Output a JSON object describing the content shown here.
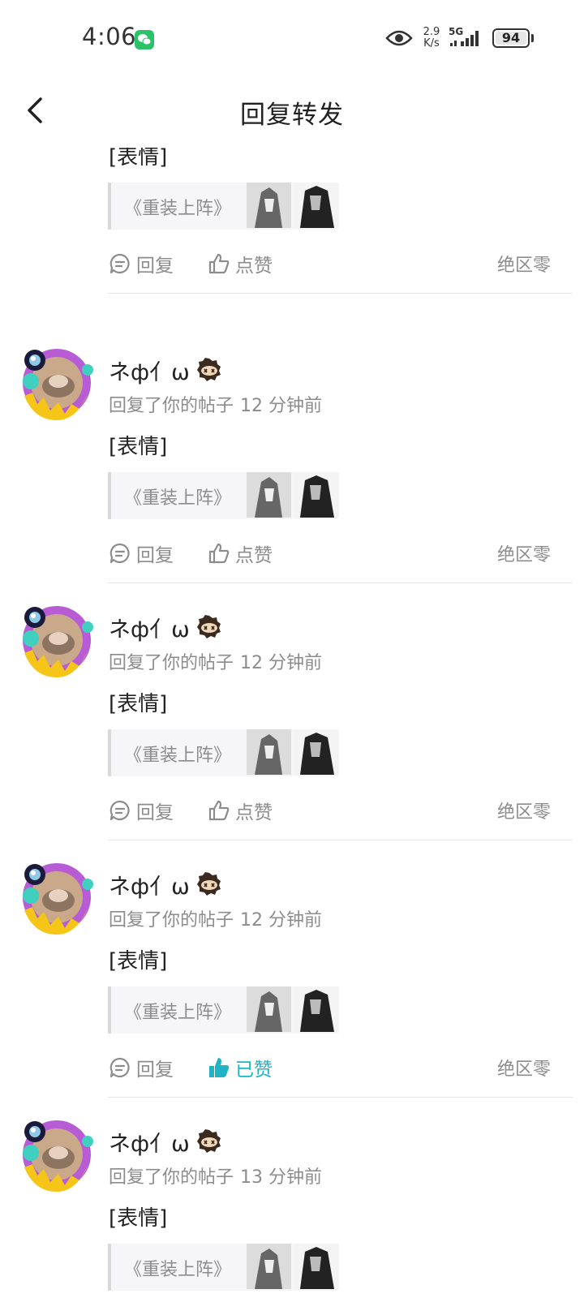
{
  "status_bar": {
    "time": "4:06",
    "net_speed_value": "2.9",
    "net_speed_unit": "K/s",
    "network": "5G",
    "battery": "94"
  },
  "header": {
    "title": "回复转发"
  },
  "labels": {
    "reply": "回复",
    "like": "点赞",
    "liked": "已赞",
    "forum": "绝区零"
  },
  "top_item": {
    "content": "[表情]",
    "quote": "《重装上阵》"
  },
  "items": [
    {
      "username": "ネф亻ω",
      "action": "回复了你的帖子",
      "time": "12 分钟前",
      "content": "[表情]",
      "quote": "《重装上阵》",
      "liked": false
    },
    {
      "username": "ネф亻ω",
      "action": "回复了你的帖子",
      "time": "12 分钟前",
      "content": "[表情]",
      "quote": "《重装上阵》",
      "liked": false
    },
    {
      "username": "ネф亻ω",
      "action": "回复了你的帖子",
      "time": "12 分钟前",
      "content": "[表情]",
      "quote": "《重装上阵》",
      "liked": true
    },
    {
      "username": "ネф亻ω",
      "action": "回复了你的帖子",
      "time": "13 分钟前",
      "content": "[表情]",
      "quote": "《重装上阵》",
      "liked": false
    }
  ]
}
